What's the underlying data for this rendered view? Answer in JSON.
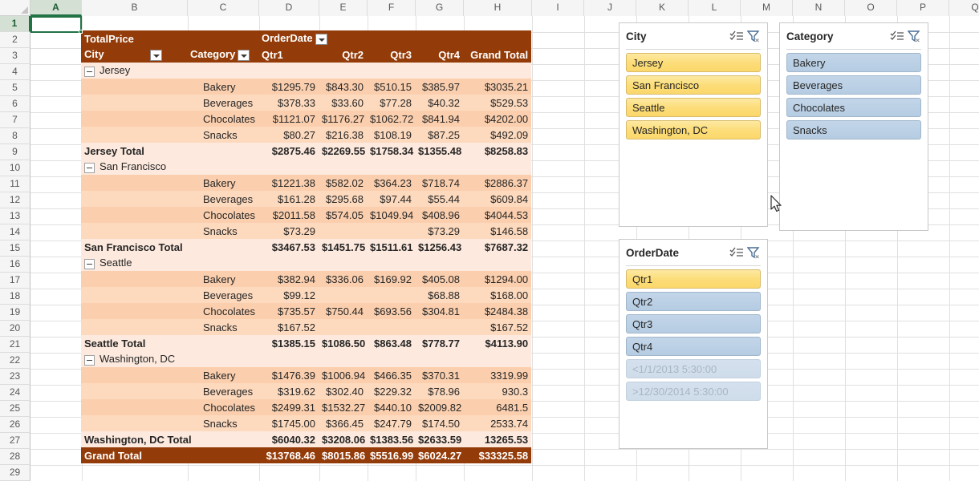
{
  "spreadsheet": {
    "columns": [
      "A",
      "B",
      "C",
      "D",
      "E",
      "F",
      "G",
      "H",
      "I",
      "J",
      "K",
      "L",
      "M",
      "N",
      "O",
      "P",
      "Q"
    ],
    "active_column": "A",
    "rows": [
      "1",
      "2",
      "3",
      "4",
      "5",
      "6",
      "7",
      "8",
      "9",
      "10",
      "11",
      "12",
      "13",
      "14",
      "15",
      "16",
      "17",
      "18",
      "19",
      "20",
      "21",
      "22",
      "23",
      "24",
      "25",
      "26",
      "27",
      "28",
      "29"
    ],
    "active_row": "1",
    "active_cell": "A1"
  },
  "pivot": {
    "value_field_label": "TotalPrice",
    "column_field_label": "OrderDate",
    "row_header_city": "City",
    "row_header_category": "Category",
    "column_headers": [
      "Qtr1",
      "Qtr2",
      "Qtr3",
      "Qtr4",
      "Grand Total"
    ],
    "groups": [
      {
        "name": "Jersey",
        "rows": [
          {
            "category": "Bakery",
            "values": [
              "$1295.79",
              "$843.30",
              "$510.15",
              "$385.97",
              "$3035.21"
            ]
          },
          {
            "category": "Beverages",
            "values": [
              "$378.33",
              "$33.60",
              "$77.28",
              "$40.32",
              "$529.53"
            ]
          },
          {
            "category": "Chocolates",
            "values": [
              "$1121.07",
              "$1176.27",
              "$1062.72",
              "$841.94",
              "$4202.00"
            ]
          },
          {
            "category": "Snacks",
            "values": [
              "$80.27",
              "$216.38",
              "$108.19",
              "$87.25",
              "$492.09"
            ]
          }
        ],
        "total_label": "Jersey Total",
        "total_values": [
          "$2875.46",
          "$2269.55",
          "$1758.34",
          "$1355.48",
          "$8258.83"
        ]
      },
      {
        "name": "San Francisco",
        "rows": [
          {
            "category": "Bakery",
            "values": [
              "$1221.38",
              "$582.02",
              "$364.23",
              "$718.74",
              "$2886.37"
            ]
          },
          {
            "category": "Beverages",
            "values": [
              "$161.28",
              "$295.68",
              "$97.44",
              "$55.44",
              "$609.84"
            ]
          },
          {
            "category": "Chocolates",
            "values": [
              "$2011.58",
              "$574.05",
              "$1049.94",
              "$408.96",
              "$4044.53"
            ]
          },
          {
            "category": "Snacks",
            "values": [
              "$73.29",
              "",
              "",
              "$73.29",
              "$146.58"
            ]
          }
        ],
        "total_label": "San Francisco Total",
        "total_values": [
          "$3467.53",
          "$1451.75",
          "$1511.61",
          "$1256.43",
          "$7687.32"
        ]
      },
      {
        "name": "Seattle",
        "rows": [
          {
            "category": "Bakery",
            "values": [
              "$382.94",
              "$336.06",
              "$169.92",
              "$405.08",
              "$1294.00"
            ]
          },
          {
            "category": "Beverages",
            "values": [
              "$99.12",
              "",
              "",
              "$68.88",
              "$168.00"
            ]
          },
          {
            "category": "Chocolates",
            "values": [
              "$735.57",
              "$750.44",
              "$693.56",
              "$304.81",
              "$2484.38"
            ]
          },
          {
            "category": "Snacks",
            "values": [
              "$167.52",
              "",
              "",
              "",
              "$167.52"
            ]
          }
        ],
        "total_label": "Seattle Total",
        "total_values": [
          "$1385.15",
          "$1086.50",
          "$863.48",
          "$778.77",
          "$4113.90"
        ]
      },
      {
        "name": "Washington, DC",
        "rows": [
          {
            "category": "Bakery",
            "values": [
              "$1476.39",
              "$1006.94",
              "$466.35",
              "$370.31",
              "3319.99"
            ]
          },
          {
            "category": "Beverages",
            "values": [
              "$319.62",
              "$302.40",
              "$229.32",
              "$78.96",
              "930.3"
            ]
          },
          {
            "category": "Chocolates",
            "values": [
              "$2499.31",
              "$1532.27",
              "$440.10",
              "$2009.82",
              "6481.5"
            ]
          },
          {
            "category": "Snacks",
            "values": [
              "$1745.00",
              "$366.45",
              "$247.79",
              "$174.50",
              "2533.74"
            ]
          }
        ],
        "total_label": "Washington, DC Total",
        "total_values": [
          "$6040.32",
          "$3208.06",
          "$1383.56",
          "$2633.59",
          "13265.53"
        ]
      }
    ],
    "grand_total_label": "Grand Total",
    "grand_total_values": [
      "$13768.46",
      "$8015.86",
      "$5516.99",
      "$6024.27",
      "$33325.58"
    ]
  },
  "slicers": [
    {
      "id": "city",
      "title": "City",
      "multiselect_icon": "multi-select-icon",
      "clear_filter_icon": "clear-filter-icon",
      "items": [
        {
          "label": "Jersey",
          "state": "gold"
        },
        {
          "label": "San Francisco",
          "state": "gold"
        },
        {
          "label": "Seattle",
          "state": "gold"
        },
        {
          "label": "Washington, DC",
          "state": "gold"
        }
      ]
    },
    {
      "id": "category",
      "title": "Category",
      "multiselect_icon": "multi-select-icon",
      "clear_filter_icon": "clear-filter-icon",
      "items": [
        {
          "label": "Bakery",
          "state": "blue"
        },
        {
          "label": "Beverages",
          "state": "blue"
        },
        {
          "label": "Chocolates",
          "state": "blue"
        },
        {
          "label": "Snacks",
          "state": "blue"
        }
      ]
    },
    {
      "id": "orderdate",
      "title": "OrderDate",
      "multiselect_icon": "multi-select-icon",
      "clear_filter_icon": "clear-filter-icon",
      "items": [
        {
          "label": "Qtr1",
          "state": "gold"
        },
        {
          "label": "Qtr2",
          "state": "blue"
        },
        {
          "label": "Qtr3",
          "state": "blue"
        },
        {
          "label": "Qtr4",
          "state": "blue"
        },
        {
          "label": "<1/1/2013 5:30:00",
          "state": "disabled"
        },
        {
          "label": ">12/30/2014 5:30:00",
          "state": "disabled"
        }
      ]
    }
  ],
  "colors": {
    "pivot_header": "#943c09",
    "pivot_band_light": "#fde9dd",
    "pivot_band_dark": "#fbcfae",
    "slicer_gold": "#fcdd7a",
    "slicer_blue": "#bcd1e6",
    "active_cell_border": "#217346"
  }
}
